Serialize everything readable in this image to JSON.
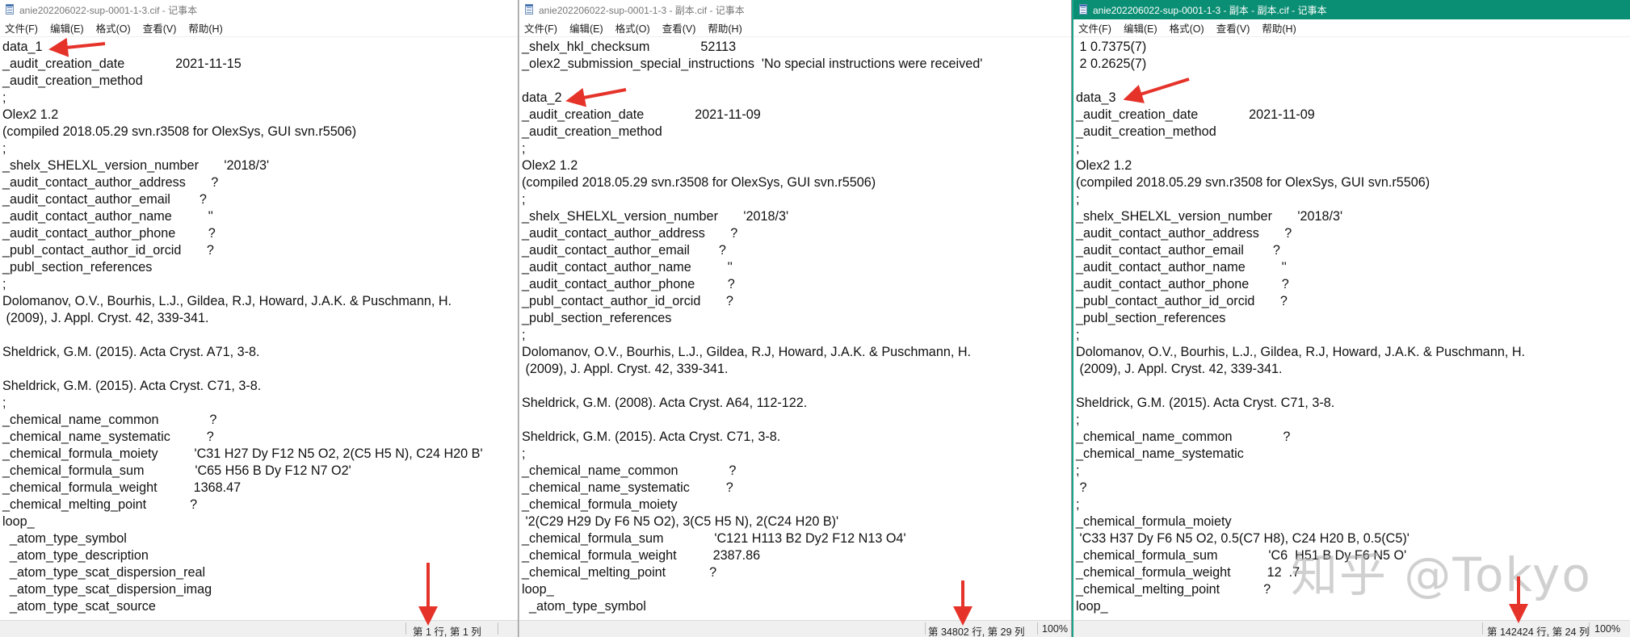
{
  "windows": [
    {
      "title": "anie202206022-sup-0001-1-3.cif - 记事本",
      "menu": [
        "文件(F)",
        "编辑(E)",
        "格式(O)",
        "查看(V)",
        "帮助(H)"
      ],
      "lines": [
        "data_1",
        "_audit_creation_date              2021-11-15",
        "_audit_creation_method",
        ";",
        "Olex2 1.2",
        "(compiled 2018.05.29 svn.r3508 for OlexSys, GUI svn.r5506)",
        ";",
        "_shelx_SHELXL_version_number       '2018/3'",
        "_audit_contact_author_address       ?",
        "_audit_contact_author_email        ?",
        "_audit_contact_author_name          ''",
        "_audit_contact_author_phone         ?",
        "_publ_contact_author_id_orcid       ?",
        "_publ_section_references",
        ";",
        "Dolomanov, O.V., Bourhis, L.J., Gildea, R.J, Howard, J.A.K. & Puschmann, H.",
        " (2009), J. Appl. Cryst. 42, 339-341.",
        "",
        "Sheldrick, G.M. (2015). Acta Cryst. A71, 3-8.",
        "",
        "Sheldrick, G.M. (2015). Acta Cryst. C71, 3-8.",
        ";",
        "_chemical_name_common              ?",
        "_chemical_name_systematic          ?",
        "_chemical_formula_moiety          'C31 H27 Dy F12 N5 O2, 2(C5 H5 N), C24 H20 B'",
        "_chemical_formula_sum              'C65 H56 B Dy F12 N7 O2'",
        "_chemical_formula_weight          1368.47",
        "_chemical_melting_point            ?",
        "loop_",
        "  _atom_type_symbol",
        "  _atom_type_description",
        "  _atom_type_scat_dispersion_real",
        "  _atom_type_scat_dispersion_imag",
        "  _atom_type_scat_source"
      ],
      "status": {
        "position": "第 1 行, 第 1 列",
        "zoom": ""
      }
    },
    {
      "title": "anie202206022-sup-0001-1-3 - 副本.cif - 记事本",
      "menu": [
        "文件(F)",
        "编辑(E)",
        "格式(O)",
        "查看(V)",
        "帮助(H)"
      ],
      "lines": [
        "_shelx_hkl_checksum              52113",
        "_olex2_submission_special_instructions  'No special instructions were received'",
        "",
        "data_2",
        "_audit_creation_date              2021-11-09",
        "_audit_creation_method",
        ";",
        "Olex2 1.2",
        "(compiled 2018.05.29 svn.r3508 for OlexSys, GUI svn.r5506)",
        ";",
        "_shelx_SHELXL_version_number       '2018/3'",
        "_audit_contact_author_address       ?",
        "_audit_contact_author_email        ?",
        "_audit_contact_author_name          ''",
        "_audit_contact_author_phone         ?",
        "_publ_contact_author_id_orcid       ?",
        "_publ_section_references",
        ";",
        "Dolomanov, O.V., Bourhis, L.J., Gildea, R.J, Howard, J.A.K. & Puschmann, H.",
        " (2009), J. Appl. Cryst. 42, 339-341.",
        "",
        "Sheldrick, G.M. (2008). Acta Cryst. A64, 112-122.",
        "",
        "Sheldrick, G.M. (2015). Acta Cryst. C71, 3-8.",
        ";",
        "_chemical_name_common              ?",
        "_chemical_name_systematic          ?",
        "_chemical_formula_moiety",
        " '2(C29 H29 Dy F6 N5 O2), 3(C5 H5 N), 2(C24 H20 B)'",
        "_chemical_formula_sum              'C121 H113 B2 Dy2 F12 N13 O4'",
        "_chemical_formula_weight          2387.86",
        "_chemical_melting_point            ?",
        "loop_",
        "  _atom_type_symbol"
      ],
      "status": {
        "position": "第 34802 行, 第 29 列",
        "zoom": "100%"
      }
    },
    {
      "title": "anie202206022-sup-0001-1-3 - 副本 - 副本.cif - 记事本",
      "menu": [
        "文件(F)",
        "编辑(E)",
        "格式(O)",
        "查看(V)",
        "帮助(H)"
      ],
      "lines": [
        " 1 0.7375(7)",
        " 2 0.2625(7)",
        "",
        "data_3",
        "_audit_creation_date              2021-11-09",
        "_audit_creation_method",
        ";",
        "Olex2 1.2",
        "(compiled 2018.05.29 svn.r3508 for OlexSys, GUI svn.r5506)",
        ";",
        "_shelx_SHELXL_version_number       '2018/3'",
        "_audit_contact_author_address       ?",
        "_audit_contact_author_email        ?",
        "_audit_contact_author_name          ''",
        "_audit_contact_author_phone         ?",
        "_publ_contact_author_id_orcid       ?",
        "_publ_section_references",
        ";",
        "Dolomanov, O.V., Bourhis, L.J., Gildea, R.J, Howard, J.A.K. & Puschmann, H.",
        " (2009), J. Appl. Cryst. 42, 339-341.",
        "",
        "Sheldrick, G.M. (2015). Acta Cryst. C71, 3-8.",
        ";",
        "_chemical_name_common              ?",
        "_chemical_name_systematic",
        ";",
        " ?",
        ";",
        "_chemical_formula_moiety",
        " 'C33 H37 Dy F6 N5 O2, 0.5(C7 H8), C24 H20 B, 0.5(C5)'",
        "_chemical_formula_sum              'C6  H51 B Dy F6 N5 O'",
        "_chemical_formula_weight          12  .7",
        "_chemical_melting_point            ?",
        "loop_"
      ],
      "status": {
        "position": "第 142424 行, 第 24 列",
        "zoom": "100%"
      }
    }
  ],
  "watermark": "知乎 @Tokyo",
  "annotation_color": "#e5332a",
  "title_accent_color": "#0b8f74"
}
